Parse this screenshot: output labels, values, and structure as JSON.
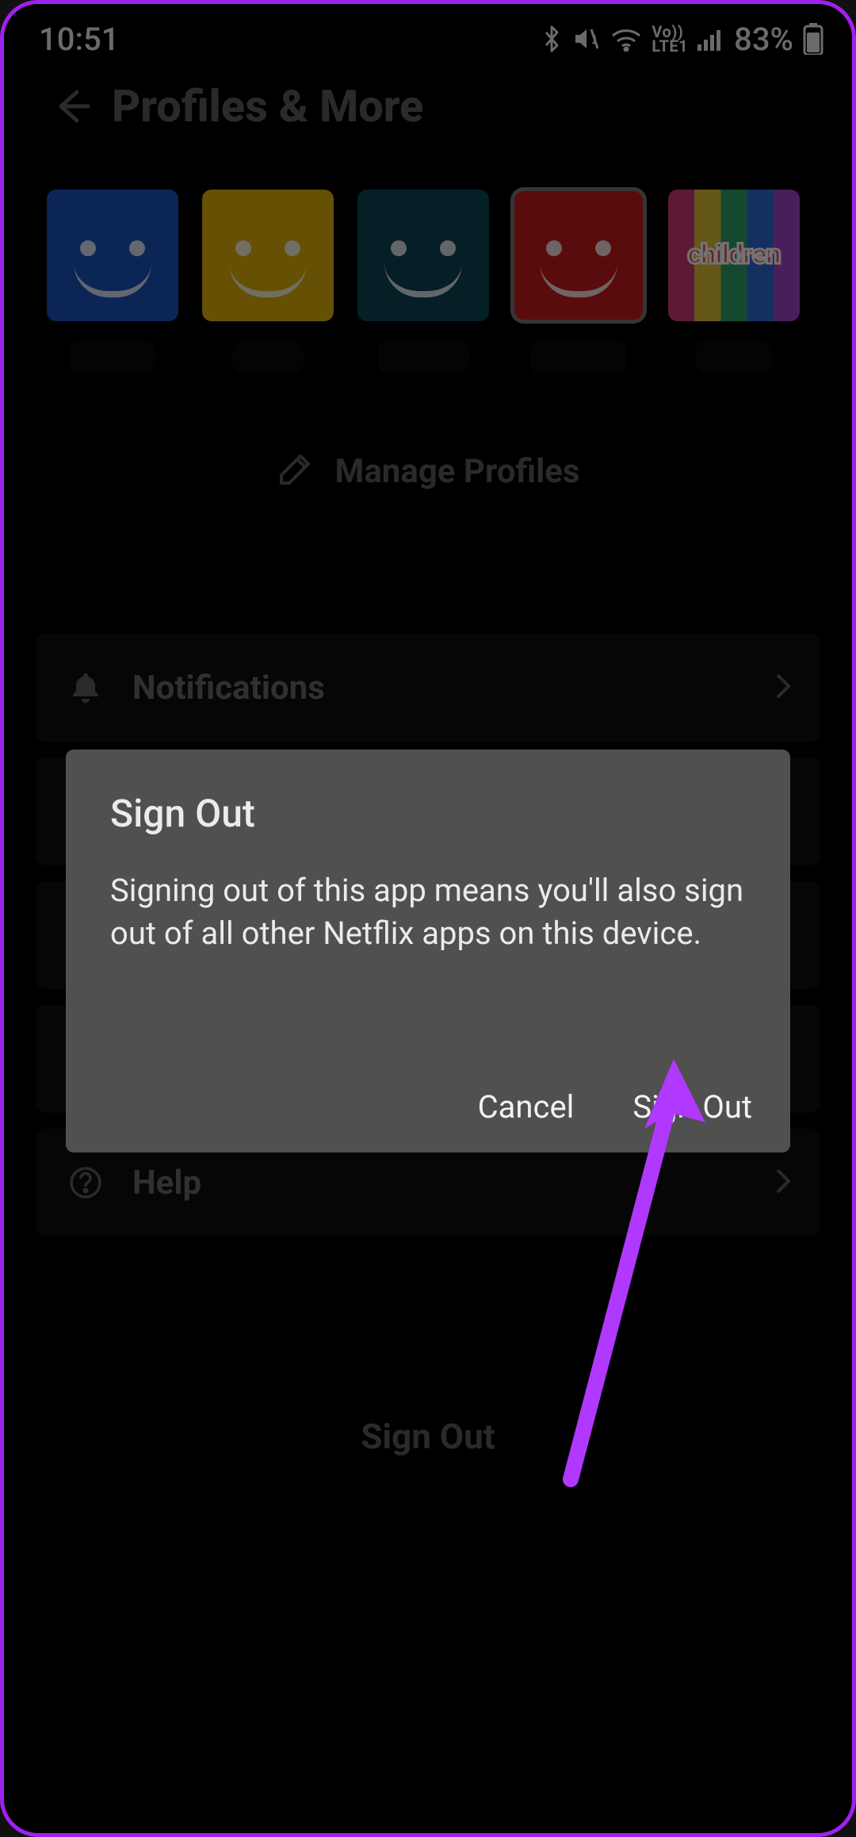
{
  "status": {
    "clock": "10:51",
    "battery": "83%"
  },
  "header": {
    "title": "Profiles & More"
  },
  "profiles": [
    {
      "color": "#1a55bf",
      "selected": false,
      "type": "avatar"
    },
    {
      "color": "#e0b20a",
      "selected": false,
      "type": "avatar"
    },
    {
      "color": "#0d4658",
      "selected": false,
      "type": "avatar"
    },
    {
      "color": "#c71a1a",
      "selected": true,
      "type": "avatar"
    },
    {
      "type": "kids",
      "label": "children",
      "selected": false
    }
  ],
  "manage_label": "Manage Profiles",
  "menu": {
    "notifications": "Notifications",
    "help": "Help"
  },
  "signout_bottom": "Sign Out",
  "dialog": {
    "title": "Sign Out",
    "body": "Signing out of this app means you'll also sign out of all other Netflix apps on this device.",
    "cancel": "Cancel",
    "confirm": "Sign Out"
  },
  "annotation": {
    "arrow_color": "#b138ff"
  }
}
